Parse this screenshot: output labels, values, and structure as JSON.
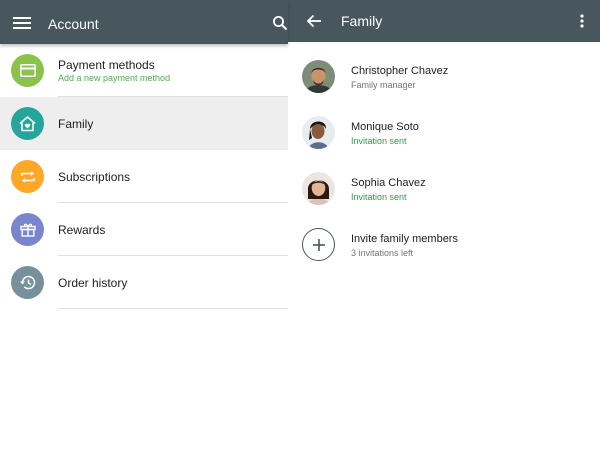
{
  "left_pane": {
    "title": "Account",
    "menu_icon": "hamburger-menu-icon",
    "search_icon": "search-icon",
    "items": [
      {
        "label": "Payment methods",
        "sublabel": "Add a new payment method",
        "icon": "credit-card-icon",
        "color": "#8bc34a"
      },
      {
        "label": "Family",
        "icon": "family-home-icon",
        "color": "#26a69a",
        "selected": true
      },
      {
        "label": "Subscriptions",
        "icon": "repeat-icon",
        "color": "#ffa726"
      },
      {
        "label": "Rewards",
        "icon": "gift-icon",
        "color": "#7986cb"
      },
      {
        "label": "Order history",
        "icon": "history-icon",
        "color": "#78909c"
      }
    ]
  },
  "right_pane": {
    "title": "Family",
    "back_icon": "back-arrow-icon",
    "overflow_icon": "more-vertical-icon",
    "members": [
      {
        "name": "Christopher Chavez",
        "status": "Family manager"
      },
      {
        "name": "Monique Soto",
        "status": "Invitation sent"
      },
      {
        "name": "Sophia Chavez",
        "status": "Invitation sent"
      }
    ],
    "invite": {
      "label": "Invite family members",
      "sublabel": "3 invitations left",
      "icon": "add-circle-icon"
    }
  },
  "colors": {
    "appbar": "#48565e",
    "selected_bg": "#eeeeee",
    "sublabel_green": "#4caf50",
    "status_green": "#2e9b4f"
  }
}
